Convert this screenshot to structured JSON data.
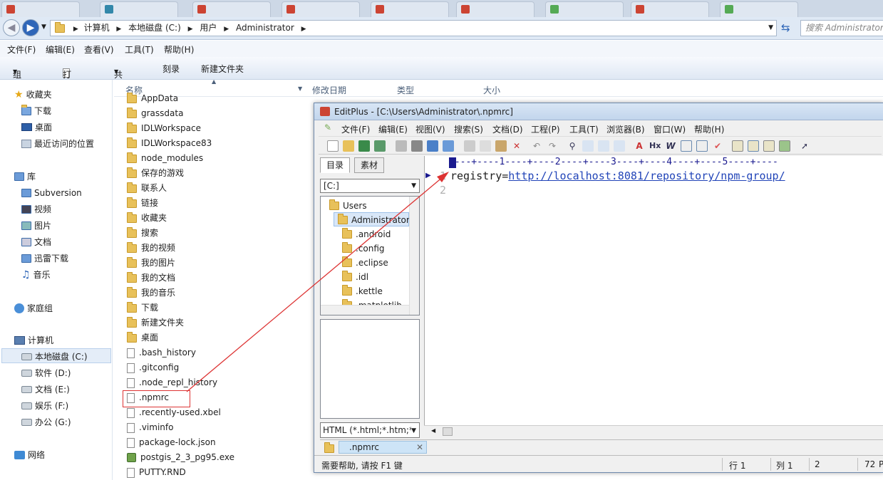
{
  "breadcrumb": [
    "计算机",
    "本地磁盘 (C:)",
    "用户",
    "Administrator"
  ],
  "search": {
    "placeholder": "搜索 Administrator"
  },
  "menu": [
    "文件(F)",
    "编辑(E)",
    "查看(V)",
    "工具(T)",
    "帮助(H)"
  ],
  "toolbar": {
    "organize": "组织",
    "open": "打开",
    "share": "共享",
    "burn": "刻录",
    "new_folder": "新建文件夹"
  },
  "nav": {
    "favorites": "收藏夹",
    "fav_items": [
      "下载",
      "桌面",
      "最近访问的位置"
    ],
    "libraries": "库",
    "lib_items": [
      "Subversion",
      "视频",
      "图片",
      "文档",
      "迅雷下载",
      "音乐"
    ],
    "homegroup": "家庭组",
    "computer": "计算机",
    "drives": [
      "本地磁盘 (C:)",
      "软件 (D:)",
      "文档 (E:)",
      "娱乐 (F:)",
      "办公 (G:)"
    ],
    "network": "网络"
  },
  "columns": {
    "name": "名称",
    "modified": "修改日期",
    "type": "类型",
    "size": "大小"
  },
  "files": [
    "AppData",
    "grassdata",
    "IDLWorkspace",
    "IDLWorkspace83",
    "node_modules",
    "保存的游戏",
    "联系人",
    "链接",
    "收藏夹",
    "搜索",
    "我的视频",
    "我的图片",
    "我的文档",
    "我的音乐",
    "下载",
    "新建文件夹",
    "桌面",
    ".bash_history",
    ".gitconfig",
    ".node_repl_history",
    ".npmrc",
    ".recently-used.xbel",
    ".viminfo",
    "package-lock.json",
    "postgis_2_3_pg95.exe",
    "PUTTY.RND"
  ],
  "editplus": {
    "title": "EditPlus - [C:\\Users\\Administrator\\.npmrc]",
    "menu": [
      "文件(F)",
      "编辑(E)",
      "视图(V)",
      "搜索(S)",
      "文档(D)",
      "工程(P)",
      "工具(T)",
      "浏览器(B)",
      "窗口(W)",
      "帮助(H)"
    ],
    "tabs": [
      "目录",
      "素材"
    ],
    "drive": "[C:]",
    "tree": [
      "Users",
      "Administrator",
      ".android",
      ".config",
      ".eclipse",
      ".idl",
      ".kettle",
      ".matplotlib"
    ],
    "filter": "HTML (*.html;*.htm;*.",
    "ruler": "----+----1----+----2----+----3----+----4----+----5----+----",
    "line_numbers": [
      "1",
      "2"
    ],
    "code": {
      "key": "registry=",
      "url": "http://localhost:8081/repository/npm-group/"
    },
    "doc_tab": ".npmrc",
    "status": {
      "help": "需要帮助, 请按 F1 键",
      "row": "行 1",
      "col": "列 1",
      "lines": "2",
      "chars": "72",
      "enc": "PC"
    }
  },
  "colors": {
    "accent": "#3a6aa8",
    "annotation": "#d33333",
    "link": "#2144b8"
  }
}
